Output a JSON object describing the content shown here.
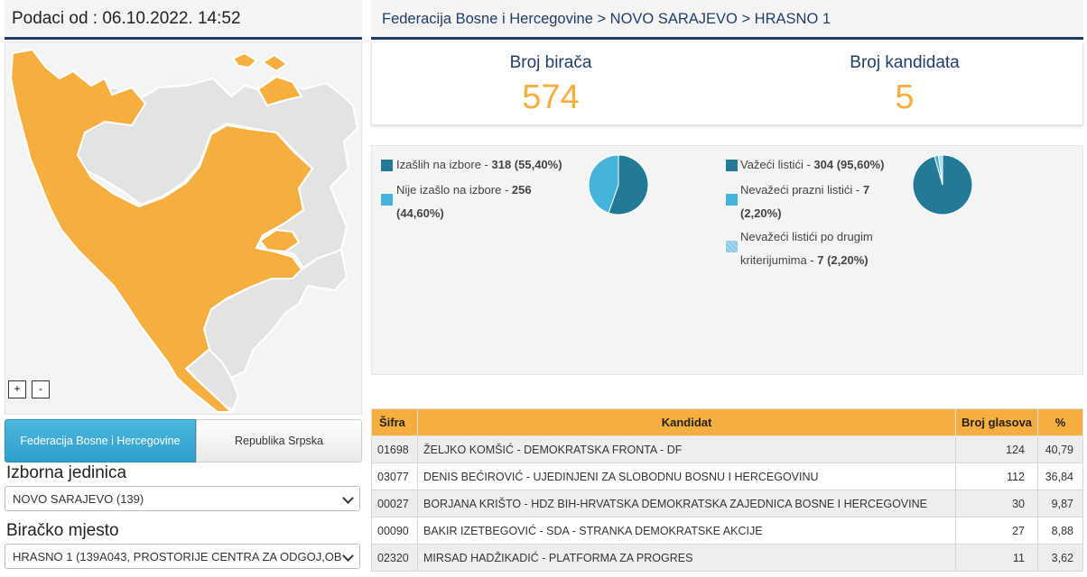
{
  "header": {
    "date_label": "Podaci od : 06.10.2022. 14:52",
    "breadcrumb": "Federacija Bosne i Hercegovine > NOVO SARAJEVO > HRASNO 1"
  },
  "map": {
    "zoom_in": "+",
    "zoom_out": "-",
    "colors": {
      "highlight": "#f6ae3e",
      "other": "#e3e3e3",
      "border": "#ffffff"
    }
  },
  "entity_tabs": {
    "active": "Federacija Bosne i Hercegovine",
    "inactive": "Republika Srpska"
  },
  "filters": {
    "unit_label": "Izborna jedinica",
    "unit_value": "NOVO SARAJEVO (139)",
    "station_label": "Biračko mjesto",
    "station_value": "HRASNO 1 (139A043, PROSTORIJE CENTRA ZA ODGOJ,OB"
  },
  "counts": {
    "voters_label": "Broj birača",
    "voters_value": "574",
    "candidates_label": "Broj kandidata",
    "candidates_value": "5"
  },
  "turnout": {
    "items": [
      {
        "label": "Izašlih na izbore - ",
        "value": "318 (55,40%)",
        "color": "#237a96",
        "fraction": 0.554
      },
      {
        "label": "Nije izašlo na izbore - ",
        "value_line1": "256",
        "value_line2": "(44,60%)",
        "color": "#45b4dc",
        "fraction": 0.446
      }
    ]
  },
  "ballots": {
    "items": [
      {
        "label": "Važeći listići - ",
        "value": "304 (95,60%)",
        "color": "#237a96",
        "fraction": 0.956
      },
      {
        "label": "Nevažeći prazni listići - ",
        "value_line1": "7",
        "value_line2": "(2,20%)",
        "color": "#45b4dc",
        "fraction": 0.022
      },
      {
        "label_line1": "Nevažeći listići po drugim",
        "label_line2": "kriterijumima - ",
        "value": "7 (2,20%)",
        "color": "#a9d8ec",
        "fraction": 0.022
      }
    ]
  },
  "results": {
    "headers": [
      "Šifra",
      "Kandidat",
      "Broj glasova",
      "%"
    ],
    "rows": [
      [
        "01698",
        "ŽELJKO KOMŠIĆ - DEMOKRATSKA FRONTA - DF",
        "124",
        "40,79"
      ],
      [
        "03077",
        "DENIS BEĆIROVIĆ - UJEDINJENI ZA SLOBODNU BOSNU I HERCEGOVINU",
        "112",
        "36,84"
      ],
      [
        "00027",
        "BORJANA KRIŠTO - HDZ BIH-HRVATSKA DEMOKRATSKA ZAJEDNICA BOSNE I HERCEGOVINE",
        "30",
        "9,87"
      ],
      [
        "00090",
        "BAKIR IZETBEGOVIĆ - SDA - STRANKA DEMOKRATSKE AKCIJE",
        "27",
        "8,88"
      ],
      [
        "02320",
        "MIRSAD HADŽIKADIĆ - PLATFORMA ZA PROGRES",
        "11",
        "3,62"
      ]
    ]
  }
}
